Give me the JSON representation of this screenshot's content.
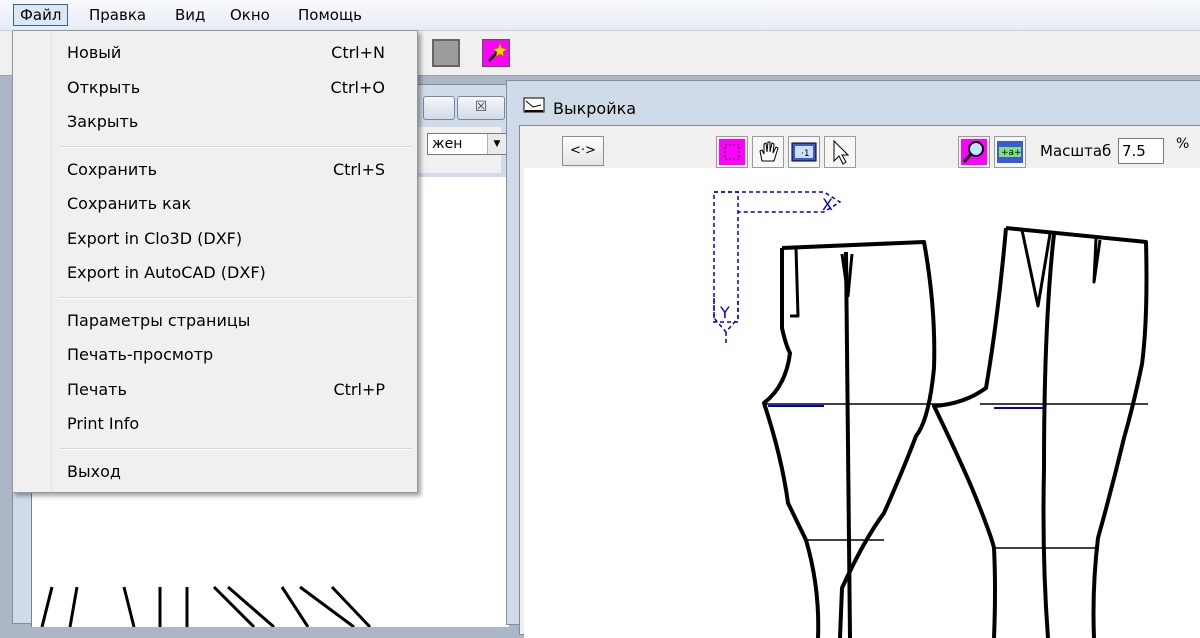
{
  "menubar": {
    "items": [
      "Файл",
      "Правка",
      "Вид",
      "Окно",
      "Помощь"
    ]
  },
  "file_menu": {
    "groups": [
      [
        {
          "label": "Новый",
          "shortcut": "Ctrl+N"
        },
        {
          "label": "Открыть",
          "shortcut": "Ctrl+O"
        },
        {
          "label": "Закрыть",
          "shortcut": ""
        }
      ],
      [
        {
          "label": "Сохранить",
          "shortcut": "Ctrl+S"
        },
        {
          "label": "Сохранить как",
          "shortcut": ""
        },
        {
          "label": "Export in Clo3D (DXF)",
          "shortcut": ""
        },
        {
          "label": "Export in AutoCAD (DXF)",
          "shortcut": ""
        }
      ],
      [
        {
          "label": "Параметры страницы",
          "shortcut": ""
        },
        {
          "label": "Печать-просмотр",
          "shortcut": ""
        },
        {
          "label": "Печать",
          "shortcut": "Ctrl+P"
        },
        {
          "label": "Print Info",
          "shortcut": ""
        }
      ],
      [
        {
          "label": "Выход",
          "shortcut": ""
        }
      ]
    ]
  },
  "left_window": {
    "combo_value": "жен",
    "close_glyph": "☒"
  },
  "pattern_window": {
    "title": "Выкройка",
    "nav_button": "<·>",
    "scale_label": "Масштаб",
    "scale_value": "7.5",
    "scale_unit": "%",
    "axis_x": "X",
    "axis_y": "Y"
  },
  "icons": {
    "toolbar": [
      "color-swatch-icon",
      "gray-swatch-icon",
      "magic-wand-icon"
    ],
    "pattern_tools": [
      "select-rect-icon",
      "hand-pan-icon",
      "ruler-icon",
      "pointer-icon",
      "zoom-icon",
      "measure-icon"
    ]
  },
  "colors": {
    "magenta": "#ff00ff",
    "axis_blue": "#0000cc",
    "menu_highlight": "#dbe7f5"
  }
}
